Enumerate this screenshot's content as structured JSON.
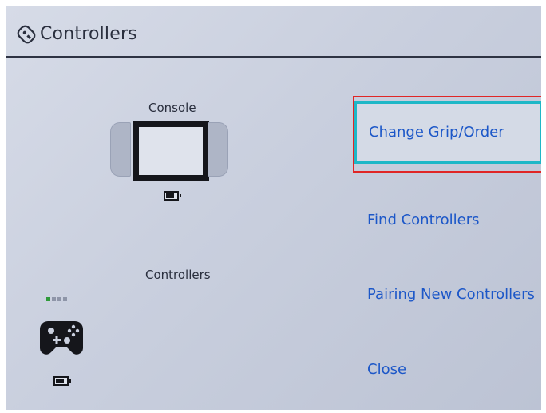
{
  "header": {
    "title": "Controllers",
    "icon": "controller-settings-icon"
  },
  "console_section": {
    "label": "Console",
    "icon": "console-icon",
    "battery_icon": "battery-icon"
  },
  "controllers_section": {
    "label": "Controllers",
    "player_lights": [
      true,
      false,
      false,
      false
    ],
    "controller_icon": "gamepad-icon",
    "battery_icon": "battery-icon"
  },
  "menu": {
    "items": [
      {
        "label": "Change Grip/Order",
        "selected": true
      },
      {
        "label": "Find Controllers",
        "selected": false
      },
      {
        "label": "Pairing New Controllers",
        "selected": false
      },
      {
        "label": "Close",
        "selected": false
      }
    ]
  },
  "colors": {
    "link": "#1c57c8",
    "selection_border": "#1eb7c7",
    "highlight_outline": "#e02626",
    "player_light_on": "#2f9a3a"
  }
}
